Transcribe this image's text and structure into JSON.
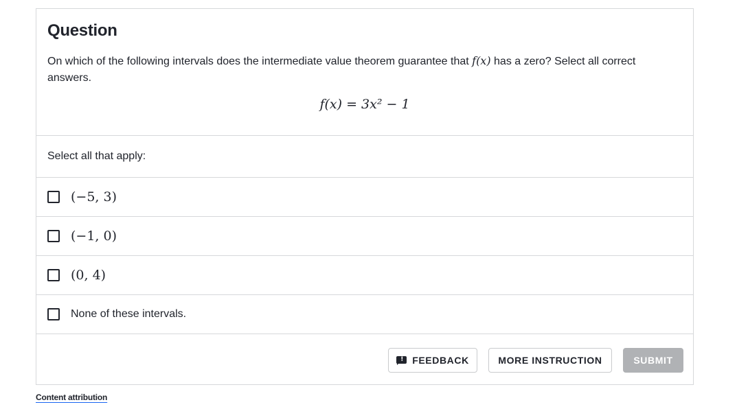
{
  "question": {
    "title": "Question",
    "text_before": "On which of the following intervals does the intermediate value theorem guarantee that ",
    "text_math": "f(x)",
    "text_after": " has a zero? Select all correct answers.",
    "formula": "f(x) = 3x² − 1"
  },
  "instructions": "Select all that apply:",
  "choices": [
    {
      "label": "(−5, 3)",
      "checked": false
    },
    {
      "label": "(−1, 0)",
      "checked": false
    },
    {
      "label": "(0, 4)",
      "checked": false
    },
    {
      "label": "None of these intervals.",
      "checked": false
    }
  ],
  "footer": {
    "feedback_label": "FEEDBACK",
    "feedback_icon": "feedback-icon",
    "more_instruction_label": "MORE INSTRUCTION",
    "submit_label": "SUBMIT"
  },
  "attribution": "Content attribution",
  "colors": {
    "text": "#21242c",
    "border": "#d6d8da",
    "submit_disabled": "#b0b2b5",
    "link_underline": "#1865f2"
  }
}
